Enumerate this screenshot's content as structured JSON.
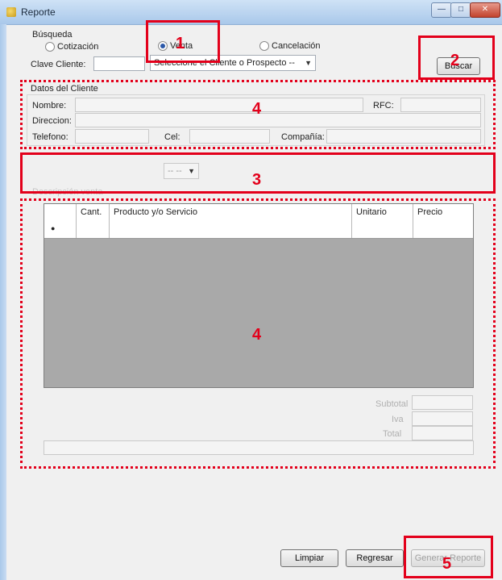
{
  "window": {
    "title": "Reporte"
  },
  "busqueda": {
    "label": "Búsqueda",
    "options": [
      {
        "label": "Cotización",
        "selected": false
      },
      {
        "label": "Venta",
        "selected": true
      },
      {
        "label": "Cancelación",
        "selected": false
      }
    ]
  },
  "clave_cliente": {
    "label": "Clave Cliente:",
    "value": ""
  },
  "client_combo": {
    "value": "Seleccione el Cliente o Prospecto --"
  },
  "buscar_button": "Buscar",
  "datos_cliente": {
    "title": "Datos del Cliente",
    "nombre": "Nombre:",
    "rfc": "RFC:",
    "direccion": "Direccion:",
    "telefono": "Telefono:",
    "cel": "Cel:",
    "compania": "Compañía:"
  },
  "section3": {
    "combo_value": "-- --",
    "label": "Descripción venta"
  },
  "grid": {
    "columns": [
      "Cant.",
      "Producto y/o Servicio",
      "Unitario",
      "Precio"
    ],
    "row_marker": "●"
  },
  "totals": {
    "subtotal": "Subtotal",
    "iva": "Iva",
    "total": "Total"
  },
  "footer": {
    "limpiar": "Limpiar",
    "regresar": "Regresar",
    "generar": "Generar Reporte"
  },
  "annotations": {
    "n1": "1",
    "n2": "2",
    "n3": "3",
    "n4a": "4",
    "n4b": "4",
    "n5": "5",
    "color": "#e3001b"
  }
}
